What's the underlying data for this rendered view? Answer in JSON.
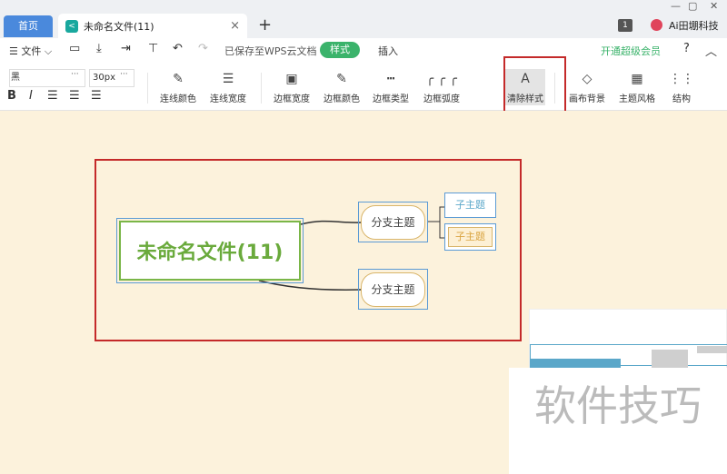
{
  "tabs": {
    "home": "首页",
    "doc_title": "未命名文件(11)",
    "close": "×",
    "add": "+"
  },
  "window": {
    "minimize": "—",
    "maximize": "▢",
    "close": "✕"
  },
  "header_right": {
    "page_count": "1",
    "user_name": "Ai田堋科技"
  },
  "menu": {
    "file": "☰ 文件 ⌵",
    "saved": "已保存至WPS云文档",
    "style_tab": "样式",
    "insert_tab": "插入",
    "vip": "开通超级会员",
    "help": "?",
    "collapse": "︿"
  },
  "font": {
    "family": "黑",
    "size": "30px",
    "more": "···"
  },
  "format": {
    "bold": "B",
    "italic": "I",
    "left": "☰",
    "center": "☰",
    "right": "☰"
  },
  "toolbar": [
    {
      "label": "连线颜色",
      "icon": "✎"
    },
    {
      "label": "连线宽度",
      "icon": "☰"
    },
    {
      "label": "边框宽度",
      "icon": "▣"
    },
    {
      "label": "边框颜色",
      "icon": "✎"
    },
    {
      "label": "边框类型",
      "icon": "┅"
    },
    {
      "label": "边框弧度",
      "icon": "╭ ╭ ╭"
    },
    {
      "label": "清除样式",
      "icon": "A"
    },
    {
      "label": "画布背景",
      "icon": "◇"
    },
    {
      "label": "主题风格",
      "icon": "▦"
    },
    {
      "label": "结构",
      "icon": "⋮⋮"
    }
  ],
  "mindmap": {
    "root": "未命名文件(11)",
    "branches": [
      {
        "label": "分支主题",
        "children": [
          "子主题",
          "子主题"
        ]
      },
      {
        "label": "分支主题",
        "children": []
      }
    ]
  },
  "watermark": "软件技巧",
  "colors": {
    "accent_green": "#3bb36b",
    "highlight_red": "#c42a2a",
    "canvas_bg": "#fcf2dc",
    "root_green": "#7ab648",
    "selection_blue": "#5b9bd5"
  }
}
